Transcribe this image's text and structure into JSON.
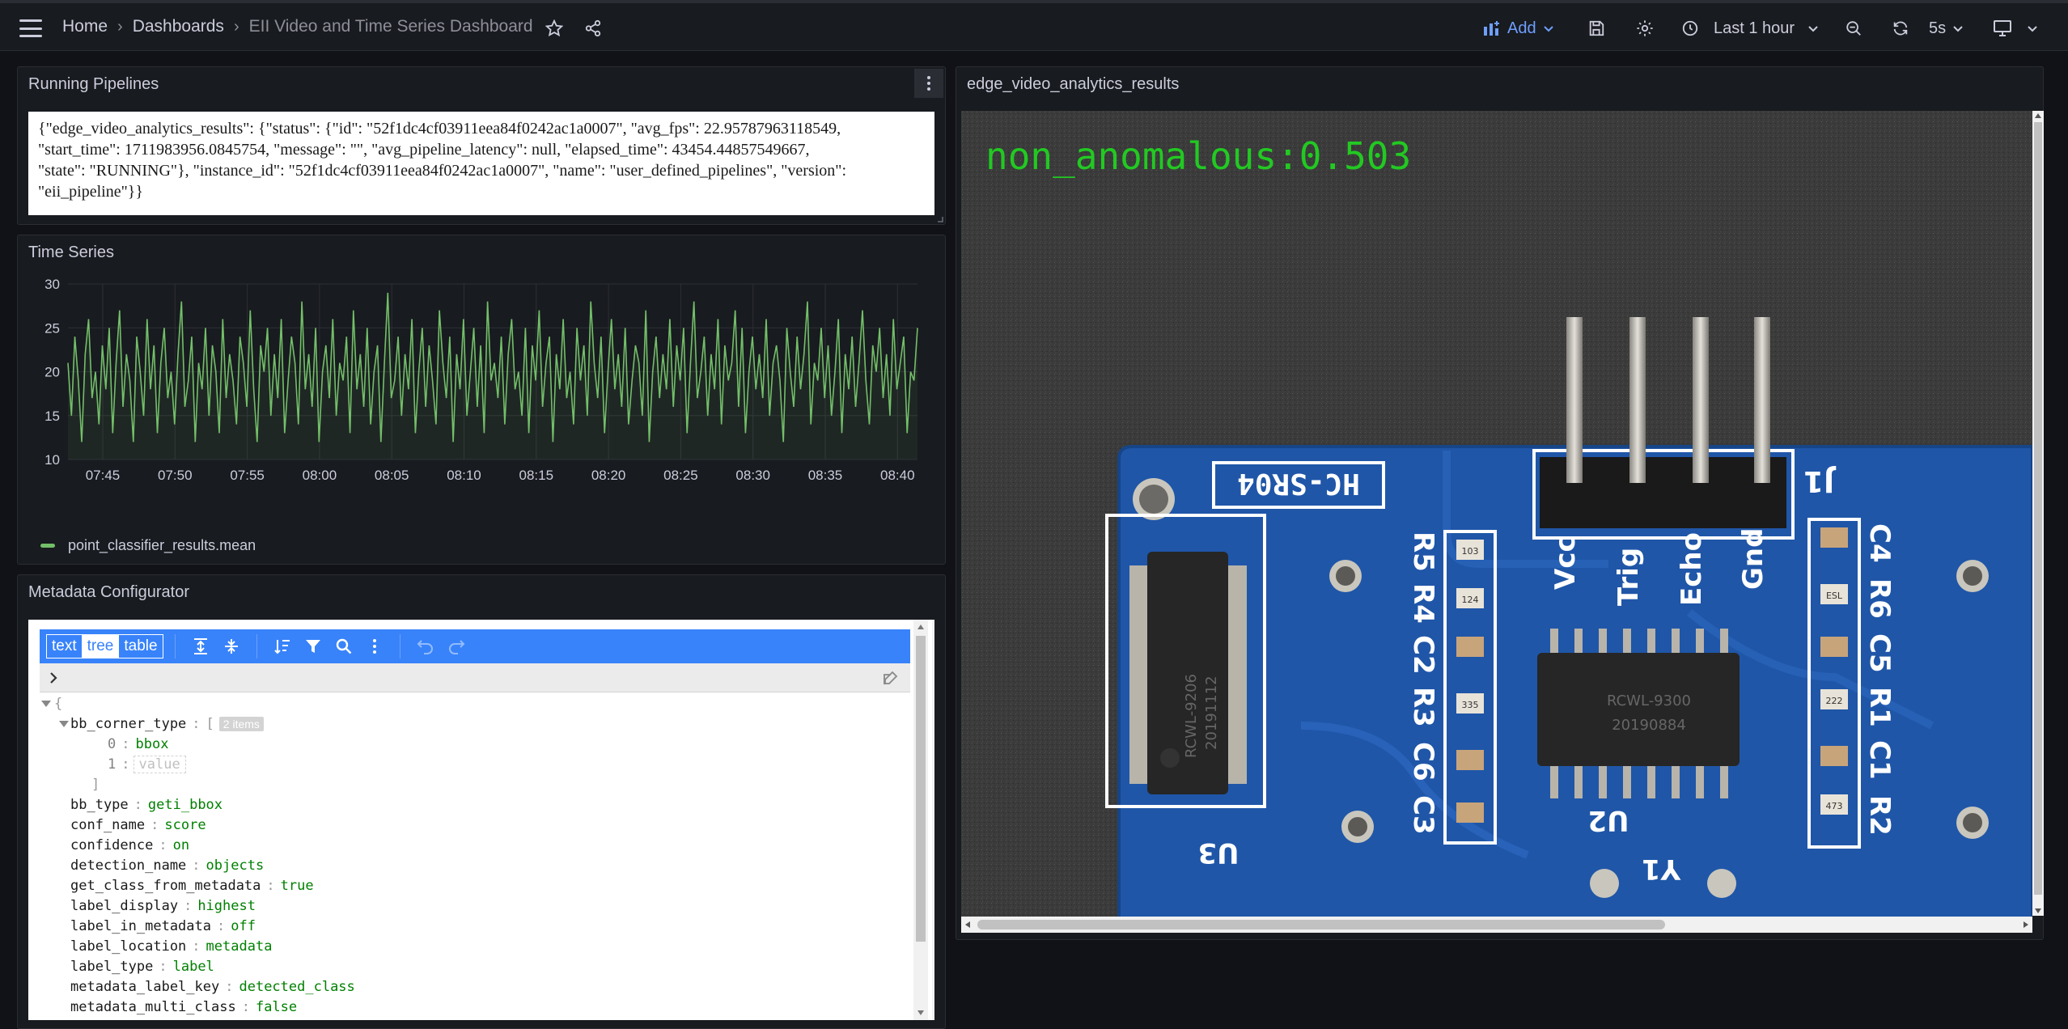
{
  "nav": {
    "breadcrumbs": [
      "Home",
      "Dashboards",
      "EII Video and Time Series Dashboard"
    ],
    "add_label": "Add",
    "time_range": "Last 1 hour",
    "refresh_interval": "5s"
  },
  "running_pipelines": {
    "title": "Running Pipelines",
    "lines": [
      "{\"edge_video_analytics_results\": {\"status\": {\"id\": \"52f1dc4cf03911eea84f0242ac1a0007\", \"avg_fps\": 22.95787963118549,",
      "\"start_time\": 1711983956.0845754, \"message\": \"\", \"avg_pipeline_latency\": null, \"elapsed_time\": 43454.44857549667,",
      "\"state\": \"RUNNING\"}, \"instance_id\": \"52f1dc4cf03911eea84f0242ac1a0007\", \"name\": \"user_defined_pipelines\", \"version\":",
      "\"eii_pipeline\"}}"
    ]
  },
  "time_series": {
    "title": "Time Series",
    "legend": "point_classifier_results.mean"
  },
  "chart_data": {
    "type": "line",
    "title": "Time Series",
    "x_ticks": [
      "07:45",
      "07:50",
      "07:55",
      "08:00",
      "08:05",
      "08:10",
      "08:15",
      "08:20",
      "08:25",
      "08:30",
      "08:35",
      "08:40"
    ],
    "y_ticks": [
      30,
      25,
      20,
      15,
      10
    ],
    "ylim": [
      10,
      30
    ],
    "series": [
      {
        "name": "point_classifier_results.mean",
        "color": "#73bf69",
        "values": [
          21,
          15,
          24,
          19,
          12,
          22,
          26,
          17,
          20,
          14,
          23,
          18,
          25,
          13,
          21,
          27,
          16,
          22,
          19,
          12,
          24,
          20,
          15,
          26,
          18,
          23,
          13,
          21,
          25,
          17,
          20,
          14,
          22,
          28,
          16,
          19,
          24,
          12,
          21,
          18,
          25,
          15,
          23,
          20,
          13,
          26,
          17,
          22,
          19,
          14,
          24,
          21,
          16,
          27,
          18,
          12,
          23,
          20,
          25,
          15,
          22,
          17,
          26,
          13,
          19,
          24,
          21,
          14,
          28,
          18,
          22,
          16,
          25,
          12,
          20,
          23,
          17,
          26,
          15,
          21,
          19,
          24,
          13,
          27,
          18,
          22,
          16,
          25,
          14,
          20,
          23,
          12,
          21,
          29,
          17,
          19,
          24,
          15,
          22,
          18,
          26,
          13,
          20,
          25,
          16,
          23,
          19,
          14,
          27,
          21,
          17,
          24,
          12,
          22,
          18,
          26,
          15,
          20,
          25,
          16,
          23,
          13,
          28,
          19,
          21,
          17,
          24,
          14,
          22,
          26,
          18,
          20,
          15,
          25,
          13,
          23,
          19,
          27,
          16,
          21,
          24,
          12,
          22,
          18,
          26,
          17,
          20,
          14,
          25,
          19,
          23,
          15,
          28,
          21,
          17,
          24,
          13,
          20,
          26,
          18,
          22,
          16,
          25,
          14,
          19,
          23,
          21,
          15,
          27,
          12,
          20,
          24,
          17,
          22,
          18,
          26,
          16,
          23,
          19,
          25,
          13,
          21,
          28,
          17,
          20,
          24,
          15,
          22,
          18,
          26,
          14,
          23,
          19,
          21,
          27,
          16,
          25,
          13,
          20,
          24,
          18,
          22,
          17,
          26,
          15,
          21,
          23,
          19,
          12,
          25,
          20,
          16,
          24,
          18,
          22,
          28,
          14,
          21,
          19,
          25,
          17,
          23,
          15,
          20,
          26,
          13,
          22,
          18,
          24,
          16,
          21,
          27,
          19,
          14,
          23,
          20,
          25,
          17,
          22,
          15,
          26,
          18,
          21,
          24,
          13,
          20,
          19,
          25
        ]
      }
    ]
  },
  "metadata": {
    "title": "Metadata Configurator",
    "modes": [
      "text",
      "tree",
      "table"
    ],
    "active_mode": "tree",
    "open_brace": "{",
    "array_key": "bb_corner_type",
    "array_open": "[",
    "array_badge": "2 items",
    "array_items": [
      {
        "index": "0",
        "value": "bbox"
      },
      {
        "index": "1",
        "value": "value"
      }
    ],
    "array_close": "]",
    "entries": [
      {
        "key": "bb_type",
        "value": "geti_bbox"
      },
      {
        "key": "conf_name",
        "value": "score"
      },
      {
        "key": "confidence",
        "value": "on"
      },
      {
        "key": "detection_name",
        "value": "objects"
      },
      {
        "key": "get_class_from_metadata",
        "value": "true"
      },
      {
        "key": "label_display",
        "value": "highest"
      },
      {
        "key": "label_in_metadata",
        "value": "off"
      },
      {
        "key": "label_location",
        "value": "metadata"
      },
      {
        "key": "label_type",
        "value": "label"
      },
      {
        "key": "metadata_label_key",
        "value": "detected_class"
      },
      {
        "key": "metadata_multi_class",
        "value": "false"
      }
    ]
  },
  "video": {
    "title": "edge_video_analytics_results",
    "overlay_text": "non_anomalous:0.503",
    "overlay_color": "#22c922",
    "board_labels": {
      "model": "HC-SR04",
      "pins": [
        "Vcc",
        "Trig",
        "Echo",
        "Gnd"
      ],
      "j1": "J1",
      "left_refs": [
        "R5",
        "R4",
        "C2",
        "R3",
        "C6",
        "C3"
      ],
      "right_refs": [
        "C4",
        "R6",
        "C5",
        "R1",
        "C1",
        "R2"
      ],
      "u3": "U3",
      "u2": "U2",
      "y1": "Y1",
      "chip_left_text": [
        "RCWL-9206",
        "20191112"
      ],
      "chip_mid_text": [
        "RCWL-9300",
        "20190884"
      ],
      "smd_codes": [
        "103",
        "124",
        "335",
        "ESL",
        "222",
        "473"
      ]
    }
  }
}
